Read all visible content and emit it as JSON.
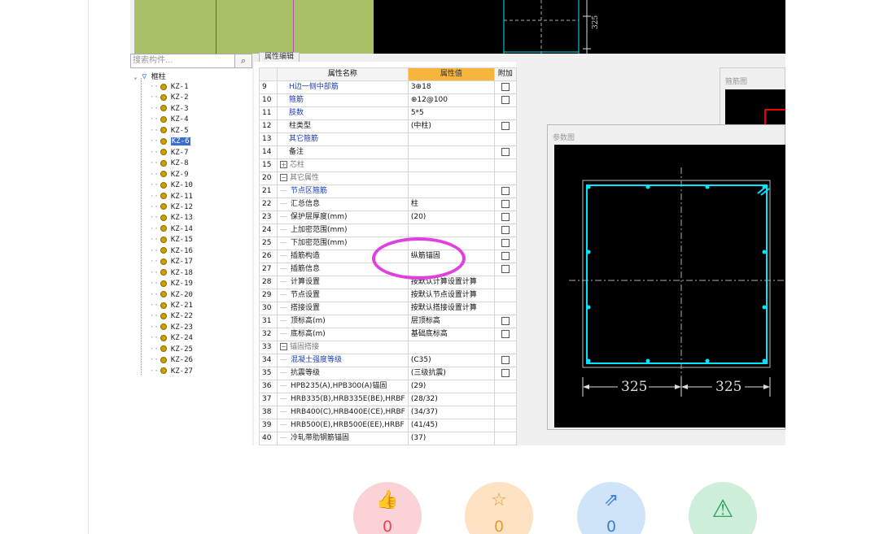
{
  "search": {
    "placeholder": "搜索构件..."
  },
  "tree": {
    "root": "框柱",
    "items": [
      "KZ-1",
      "KZ-2",
      "KZ-3",
      "KZ-4",
      "KZ-5",
      "KZ-6",
      "KZ-7",
      "KZ-8",
      "KZ-9",
      "KZ-10",
      "KZ-11",
      "KZ-12",
      "KZ-13",
      "KZ-14",
      "KZ-15",
      "KZ-16",
      "KZ-17",
      "KZ-18",
      "KZ-19",
      "KZ-20",
      "KZ-21",
      "KZ-22",
      "KZ-23",
      "KZ-24",
      "KZ-25",
      "KZ-26",
      "KZ-27"
    ],
    "selected": "KZ-6"
  },
  "props": {
    "tab": "属性编辑",
    "headers": {
      "name": "属性名称",
      "value": "属性值",
      "extra": "附加"
    },
    "rows": [
      {
        "num": "9",
        "name": "H边一侧中部筋",
        "value": "3⊕18",
        "style": "blue",
        "check": true
      },
      {
        "num": "10",
        "name": "箍筋",
        "value": "⊕12@100",
        "style": "blue",
        "check": true
      },
      {
        "num": "11",
        "name": "肢数",
        "value": "5*5",
        "style": "blue",
        "check": false
      },
      {
        "num": "12",
        "name": "柱类型",
        "value": "(中柱)",
        "style": "",
        "check": true
      },
      {
        "num": "13",
        "name": "其它箍筋",
        "value": "",
        "style": "blue",
        "check": false
      },
      {
        "num": "14",
        "name": "备注",
        "value": "",
        "style": "",
        "check": true
      },
      {
        "num": "15",
        "name": "芯柱",
        "value": "",
        "style": "gray",
        "check": false,
        "toggle": "+"
      },
      {
        "num": "20",
        "name": "其它属性",
        "value": "",
        "style": "gray",
        "check": false,
        "toggle": "−"
      },
      {
        "num": "21",
        "name": "节点区箍筋",
        "value": "",
        "style": "blue",
        "check": true,
        "child": true
      },
      {
        "num": "22",
        "name": "汇总信息",
        "value": "柱",
        "style": "",
        "check": true,
        "child": true
      },
      {
        "num": "23",
        "name": "保护层厚度(mm)",
        "value": "(20)",
        "style": "",
        "check": true,
        "child": true
      },
      {
        "num": "24",
        "name": "上加密范围(mm)",
        "value": "",
        "style": "",
        "check": true,
        "child": true
      },
      {
        "num": "25",
        "name": "下加密范围(mm)",
        "value": "",
        "style": "",
        "check": true,
        "child": true
      },
      {
        "num": "26",
        "name": "插筋构造",
        "value": "纵筋锚固",
        "style": "",
        "check": true,
        "child": true
      },
      {
        "num": "27",
        "name": "插筋信息",
        "value": "",
        "style": "",
        "check": true,
        "child": true
      },
      {
        "num": "28",
        "name": "计算设置",
        "value": "按默认计算设置计算",
        "style": "",
        "check": false,
        "child": true
      },
      {
        "num": "29",
        "name": "节点设置",
        "value": "按默认节点设置计算",
        "style": "",
        "check": false,
        "child": true
      },
      {
        "num": "30",
        "name": "搭接设置",
        "value": "按默认搭接设置计算",
        "style": "",
        "check": false,
        "child": true
      },
      {
        "num": "31",
        "name": "顶标高(m)",
        "value": "层顶标高",
        "style": "",
        "check": true,
        "child": true
      },
      {
        "num": "32",
        "name": "底标高(m)",
        "value": "基础底标高",
        "style": "",
        "check": true,
        "child": true
      },
      {
        "num": "33",
        "name": "锚固搭接",
        "value": "",
        "style": "gray",
        "check": false,
        "toggle": "−"
      },
      {
        "num": "34",
        "name": "混凝土强度等级",
        "value": "(C35)",
        "style": "blue",
        "check": true,
        "child": true
      },
      {
        "num": "35",
        "name": "抗震等级",
        "value": "(三级抗震)",
        "style": "",
        "check": true,
        "child": true
      },
      {
        "num": "36",
        "name": "HPB235(A),HPB300(A)锚固",
        "value": "(29)",
        "style": "",
        "check": false,
        "child": true
      },
      {
        "num": "37",
        "name": "HRB335(B),HRB335E(BE),HRBF",
        "value": "(28/32)",
        "style": "",
        "check": false,
        "child": true
      },
      {
        "num": "38",
        "name": "HRB400(C),HRB400E(CE),HRBF",
        "value": "(34/37)",
        "style": "",
        "check": false,
        "child": true
      },
      {
        "num": "39",
        "name": "HRB500(E),HRB500E(EE),HRBF",
        "value": "(41/45)",
        "style": "",
        "check": false,
        "child": true
      },
      {
        "num": "40",
        "name": "冷轧带肋钢筋锚固",
        "value": "(37)",
        "style": "",
        "check": false,
        "child": true
      }
    ]
  },
  "hoop_window": {
    "title": "箍筋图"
  },
  "param_window": {
    "title": "参数图",
    "dim_left": "325",
    "dim_right": "325"
  },
  "top_dim": "325",
  "actions": [
    {
      "name": "like",
      "icon": "👍",
      "count": "0",
      "bg": "#fbd3d6",
      "color": "#e0485a"
    },
    {
      "name": "favorite",
      "icon": "☆",
      "count": "0",
      "bg": "#fde3c4",
      "color": "#e49b34"
    },
    {
      "name": "share",
      "icon": "⇗",
      "count": "0",
      "bg": "#cfe3f9",
      "color": "#3c7fd6"
    },
    {
      "name": "report",
      "icon": "⚠",
      "count": "",
      "bg": "#cdeed9",
      "color": "#2aa55a"
    }
  ],
  "colors": {
    "accent_orange": "#f7b53c",
    "drawing_cyan": "#00e5ff",
    "highlight_magenta": "#e040e0"
  }
}
